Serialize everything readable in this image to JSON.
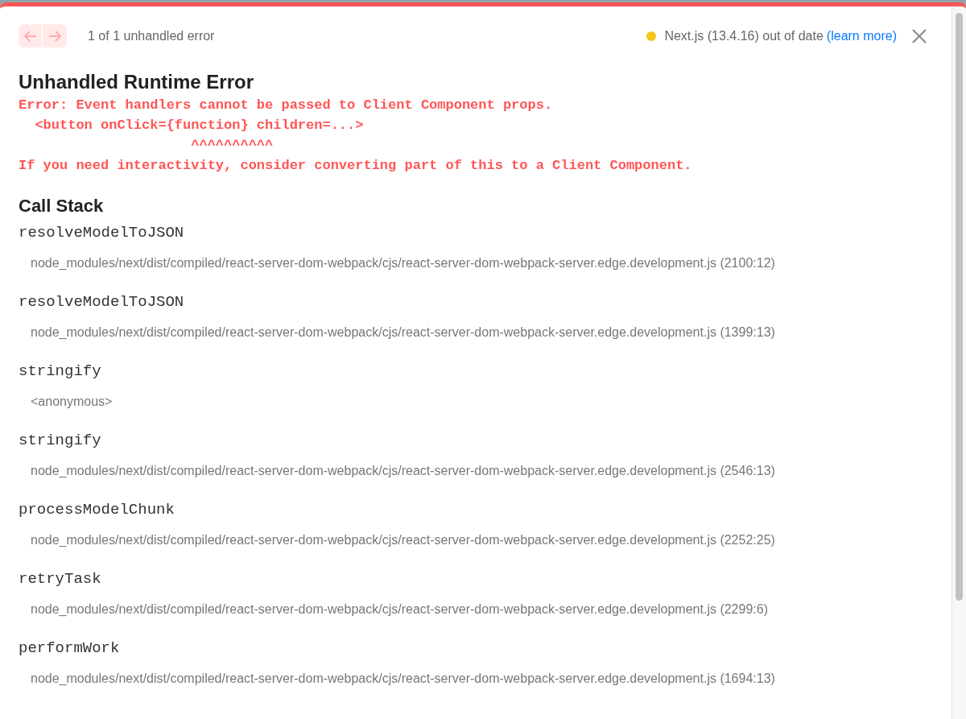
{
  "nav": {
    "prev_disabled": true,
    "next_disabled": true
  },
  "counter": "1 of 1 unhandled error",
  "version": {
    "color": "#f5c518",
    "text": "Next.js (13.4.16) out of date",
    "link": "(learn more)"
  },
  "title": "Unhandled Runtime Error",
  "error_lines": [
    "Error: Event handlers cannot be passed to Client Component props.",
    "  <button onClick={function} children=...>",
    "                     ^^^^^^^^^^",
    "If you need interactivity, consider converting part of this to a Client Component."
  ],
  "call_stack": {
    "heading": "Call Stack",
    "frames": [
      {
        "function": "resolveModelToJSON",
        "location": "node_modules/next/dist/compiled/react-server-dom-webpack/cjs/react-server-dom-webpack-server.edge.development.js (2100:12)"
      },
      {
        "function": "resolveModelToJSON",
        "location": "node_modules/next/dist/compiled/react-server-dom-webpack/cjs/react-server-dom-webpack-server.edge.development.js (1399:13)"
      },
      {
        "function": "stringify",
        "location": "<anonymous>"
      },
      {
        "function": "stringify",
        "location": "node_modules/next/dist/compiled/react-server-dom-webpack/cjs/react-server-dom-webpack-server.edge.development.js (2546:13)"
      },
      {
        "function": "processModelChunk",
        "location": "node_modules/next/dist/compiled/react-server-dom-webpack/cjs/react-server-dom-webpack-server.edge.development.js (2252:25)"
      },
      {
        "function": "retryTask",
        "location": "node_modules/next/dist/compiled/react-server-dom-webpack/cjs/react-server-dom-webpack-server.edge.development.js (2299:6)"
      },
      {
        "function": "performWork",
        "location": "node_modules/next/dist/compiled/react-server-dom-webpack/cjs/react-server-dom-webpack-server.edge.development.js (1694:13)"
      }
    ]
  }
}
